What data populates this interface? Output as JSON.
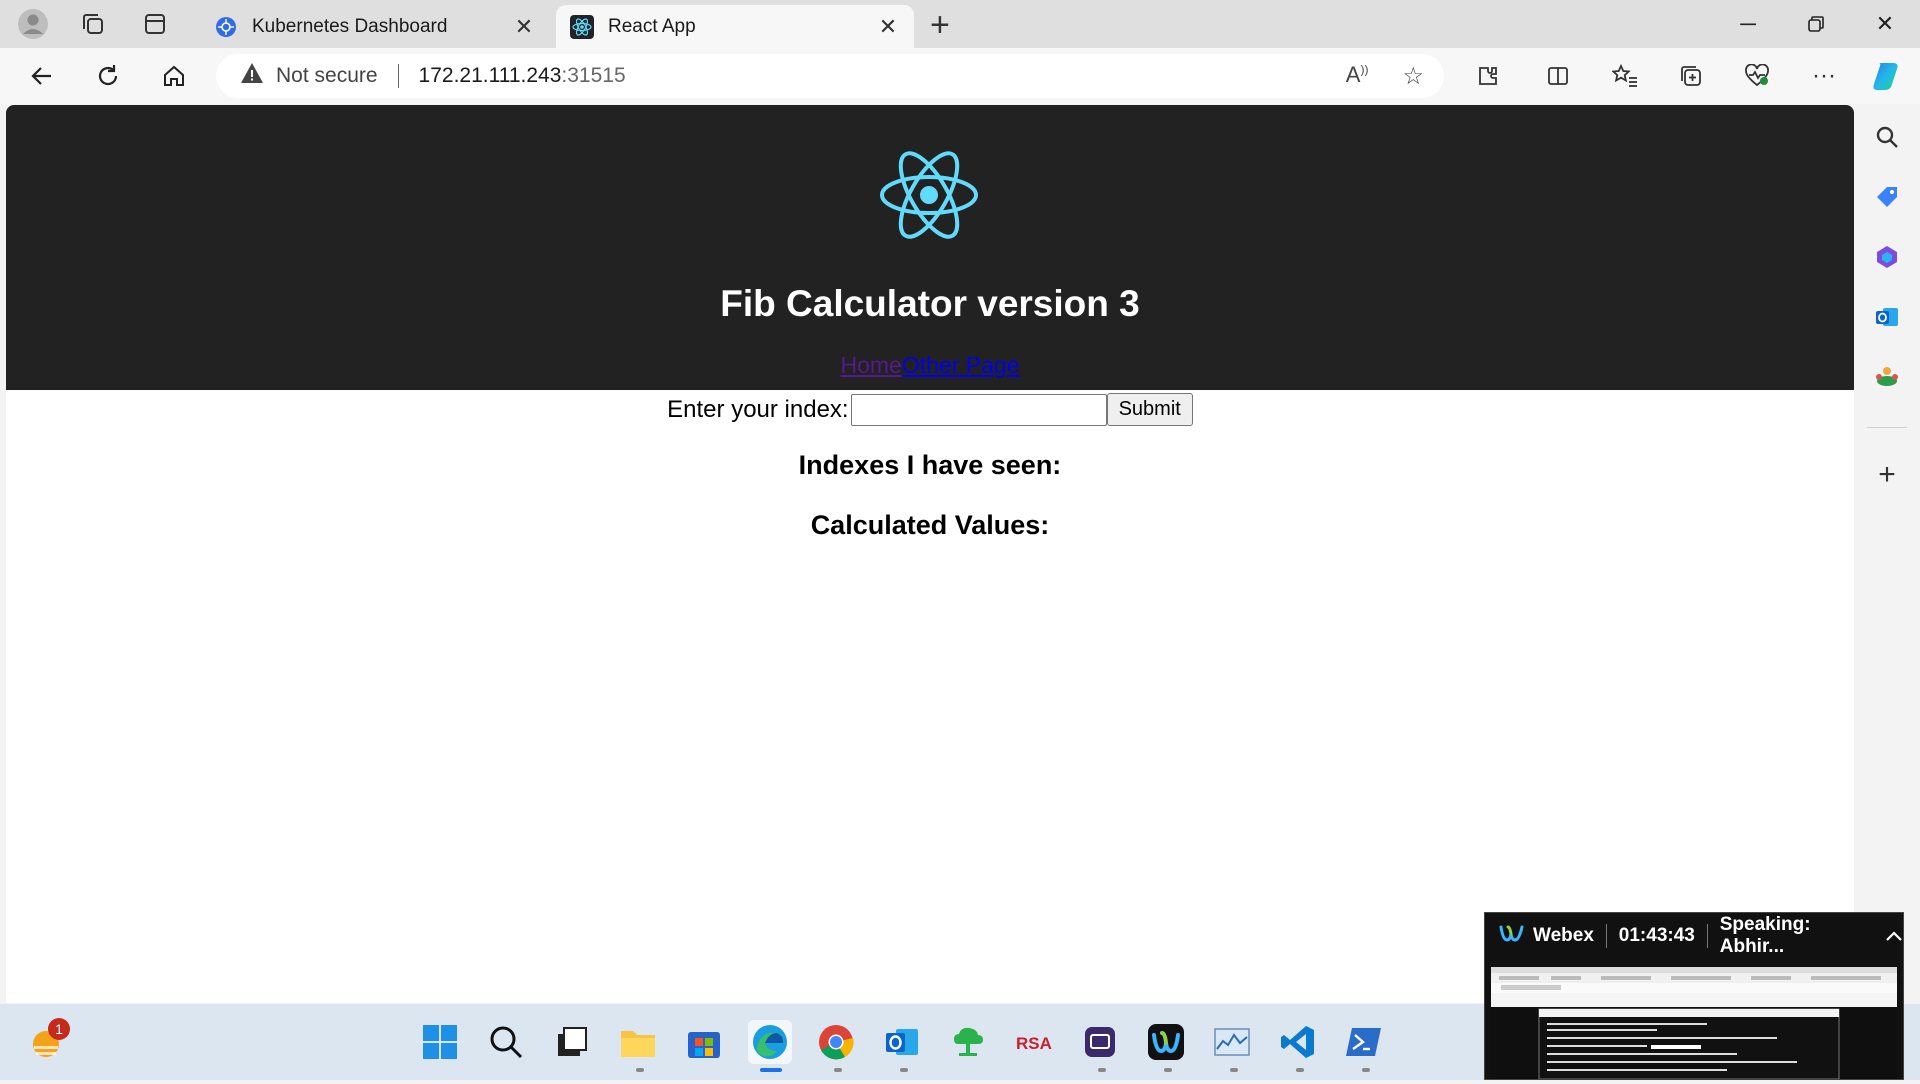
{
  "browser": {
    "tabs": [
      {
        "title": "Kubernetes Dashboard",
        "active": false
      },
      {
        "title": "React App",
        "active": true
      }
    ],
    "address": {
      "security_label": "Not secure",
      "host": "172.21.111.243",
      "port": ":31515"
    }
  },
  "app": {
    "title": "Fib Calculator version 3",
    "nav": {
      "home": "Home",
      "other": "Other Page"
    },
    "form": {
      "label": "Enter your index:",
      "input_value": "",
      "submit": "Submit"
    },
    "indexes_heading": "Indexes I have seen:",
    "values_heading": "Calculated Values:"
  },
  "webex": {
    "app": "Webex",
    "timer": "01:43:43",
    "speaking": "Speaking: Abhir..."
  },
  "taskbar": {
    "notification_count": "1"
  },
  "colors": {
    "header_bg": "#222222",
    "react_logo": "#61dafb",
    "visited_link": "#551a8b",
    "link": "#0000ee"
  }
}
